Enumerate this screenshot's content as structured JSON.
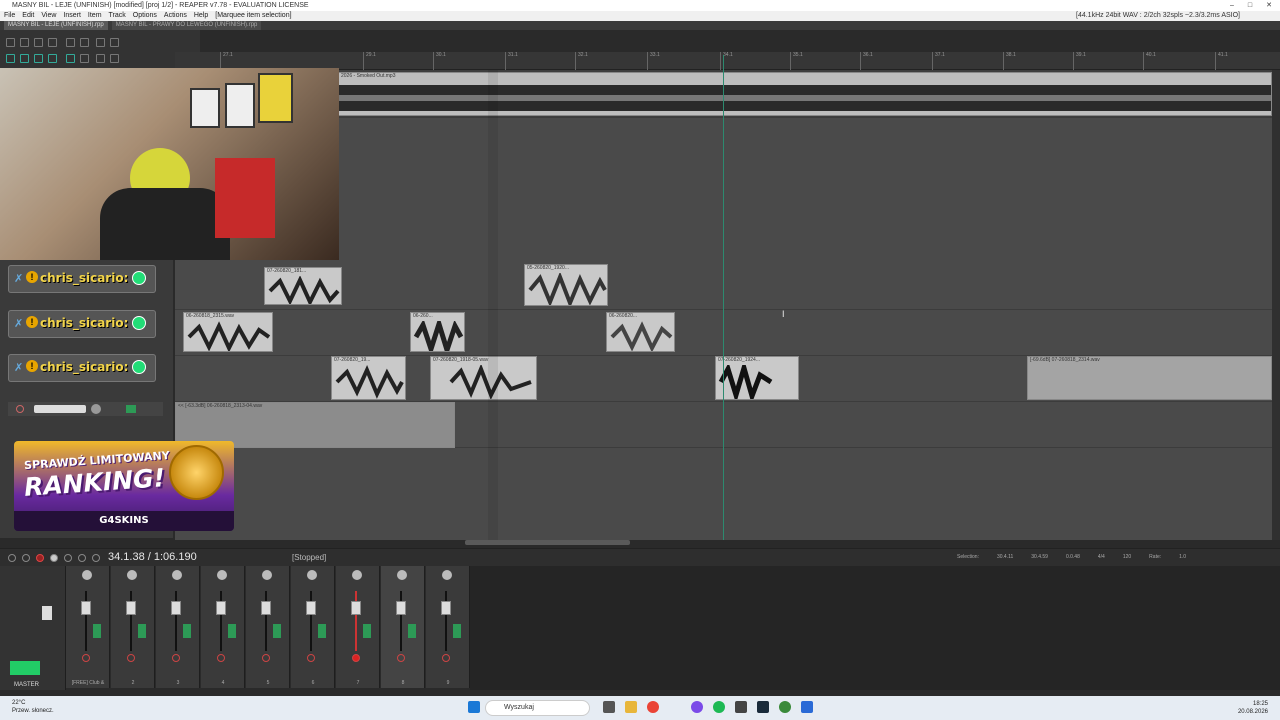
{
  "window": {
    "title": "MASNY BIL - LEJE (UNFINISH) [modified] [proj 1/2] - REAPER v7.78 - EVALUATION LICENSE",
    "controls": [
      "–",
      "□",
      "✕"
    ]
  },
  "menu": {
    "items": [
      "File",
      "Edit",
      "View",
      "Insert",
      "Item",
      "Track",
      "Options",
      "Actions",
      "Help"
    ],
    "context_hint": "[Marquee item selection]",
    "audio_status": "[44.1kHz 24bit WAV : 2/2ch 32spls ~2.3/3.2ms ASIO]"
  },
  "project_tabs": [
    {
      "label": "MASNY BIL - LEJE (UNFINISH).rpp",
      "active": true
    },
    {
      "label": "MASNY BIL - PRAWY DO LEWEGO (UNFINISH).rpp",
      "active": false
    }
  ],
  "ruler": {
    "ticks": [
      "27.1",
      "29.1",
      "30.1",
      "31.1",
      "32.1",
      "33.1",
      "34.1",
      "35.1",
      "36.1",
      "37.1",
      "38.1",
      "39.1",
      "40.1",
      "41.1"
    ]
  },
  "tracks": {
    "top_item_label": "2026 - Smoked Out.mp3",
    "items": [
      {
        "label": "07-260820_181..."
      },
      {
        "label": "05-260820_1920..."
      },
      {
        "label": "06-260818_2315.wav"
      },
      {
        "label": "06-260..."
      },
      {
        "label": "06-260820..."
      },
      {
        "label": "07-260820_19..."
      },
      {
        "label": "07-260820_1918-05.wav"
      },
      {
        "label": "07-260820_1924..."
      },
      {
        "label": "[-69.6dB] 07-260818_2314.wav"
      },
      {
        "label": "<< [-63.3dB] 06-260818_2313-04.wav"
      }
    ]
  },
  "stream_overlay": {
    "chat_rows": [
      {
        "name": "chris_sicario:"
      },
      {
        "name": "chris_sicario:"
      },
      {
        "name": "chris_sicario:"
      }
    ],
    "banner": {
      "line1": "SPRAWDŹ LIMITOWANY",
      "line2": "RANKING!",
      "brand": "G4SKINS"
    }
  },
  "transport": {
    "position": "34.1.38 / 1:06.190",
    "state": "[Stopped]",
    "selection_label": "Selection:",
    "selection_start": "30.4.11",
    "selection_end": "30.4.59",
    "selection_length": "0.0.48",
    "time_sig": "4/4",
    "bpm": "120",
    "rate_label": "Rate:",
    "rate_value": "1.0"
  },
  "mixer": {
    "master_label": "MASTER",
    "strips": [
      {
        "name": "[FREE] Club &"
      },
      {
        "name": "2"
      },
      {
        "name": "3"
      },
      {
        "name": "4"
      },
      {
        "name": "5"
      },
      {
        "name": "6"
      },
      {
        "name": "7"
      },
      {
        "name": "8"
      },
      {
        "name": "9"
      }
    ]
  },
  "taskbar": {
    "weather_temp": "22°C",
    "weather_desc": "Przew. słonecz.",
    "search_placeholder": "Wyszukaj",
    "time": "18:25",
    "date": "20.08.2026"
  },
  "colors": {
    "arrange_bg": "#4a4a4a",
    "item_bg": "#c9c9c9",
    "cursor": "#2d8a6f",
    "chat_name": "#f3d54a",
    "fx_green": "#2d9a56"
  }
}
